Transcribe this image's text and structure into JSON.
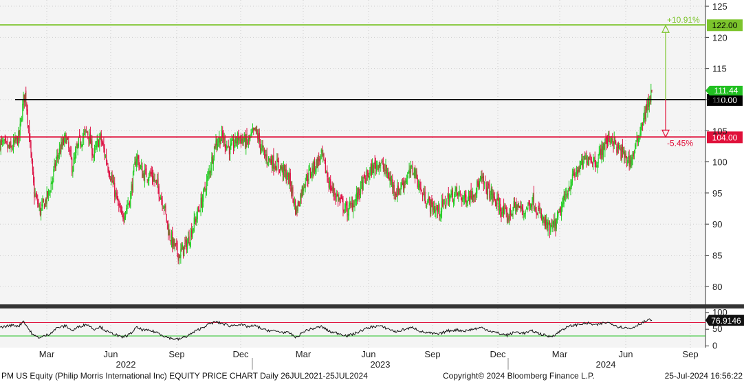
{
  "chart_data": {
    "type": "candlestick",
    "ticker": "PM US Equity",
    "price_axis": {
      "ylim": [
        77,
        126
      ],
      "ticks": [
        "125",
        "120",
        "115",
        "110",
        "105",
        "100",
        "95",
        "90",
        "85",
        "80"
      ]
    },
    "rsi_axis": {
      "ylim": [
        -5,
        112
      ],
      "ticks": [
        "100",
        "50",
        "0"
      ]
    },
    "x_labels": [
      {
        "label": "Mar"
      },
      {
        "label": "Jun"
      },
      {
        "label": "Sep"
      },
      {
        "label": "Dec"
      },
      {
        "label": "Mar"
      },
      {
        "label": "Jun"
      },
      {
        "label": "Sep"
      },
      {
        "label": "Dec"
      },
      {
        "label": "Mar"
      },
      {
        "label": "Jun"
      },
      {
        "label": "Sep"
      }
    ],
    "year_labels": [
      "2022",
      "2023",
      "2024"
    ],
    "horizontal_lines": [
      {
        "value": 122.0,
        "label": "122.00",
        "color": "#7cc42c"
      },
      {
        "value": 110.0,
        "label": "110.00",
        "color": "#000000"
      },
      {
        "value": 104.0,
        "label": "104.00",
        "color": "#e0103a"
      }
    ],
    "last_price": {
      "value": 111.44,
      "label": "111.44",
      "color": "#22c022"
    },
    "annotations": [
      {
        "text": "+10.91%",
        "color": "#7cc42c"
      },
      {
        "text": "-5.45%",
        "color": "#e0103a"
      }
    ],
    "rsi": {
      "last_label": "76.9146",
      "reference_lines": [
        {
          "value": 70,
          "color": "#e0103a"
        },
        {
          "value": 30,
          "color": "#22c022"
        }
      ]
    },
    "price_path": [
      [
        0,
        103
      ],
      [
        5,
        102
      ],
      [
        9,
        104
      ],
      [
        11,
        110
      ],
      [
        12,
        111
      ],
      [
        14,
        103
      ],
      [
        16,
        95
      ],
      [
        19,
        92
      ],
      [
        23,
        95
      ],
      [
        27,
        101
      ],
      [
        31,
        104
      ],
      [
        34,
        99
      ],
      [
        37,
        103
      ],
      [
        41,
        105
      ],
      [
        44,
        101
      ],
      [
        47,
        104
      ],
      [
        51,
        99
      ],
      [
        54,
        95
      ],
      [
        57,
        91
      ],
      [
        61,
        94
      ],
      [
        64,
        101
      ],
      [
        67,
        98
      ],
      [
        71,
        98
      ],
      [
        74,
        96
      ],
      [
        77,
        93
      ],
      [
        79,
        89
      ],
      [
        81,
        87
      ],
      [
        84,
        85
      ],
      [
        88,
        87
      ],
      [
        92,
        91
      ],
      [
        95,
        94
      ],
      [
        98,
        98
      ],
      [
        101,
        103
      ],
      [
        104,
        104
      ],
      [
        108,
        102
      ],
      [
        112,
        104
      ],
      [
        116,
        103
      ],
      [
        120,
        105
      ],
      [
        124,
        101
      ],
      [
        128,
        100
      ],
      [
        132,
        99
      ],
      [
        136,
        97
      ],
      [
        139,
        92
      ],
      [
        143,
        97
      ],
      [
        147,
        99
      ],
      [
        151,
        101
      ],
      [
        155,
        96
      ],
      [
        159,
        94
      ],
      [
        163,
        92
      ],
      [
        167,
        94
      ],
      [
        171,
        97
      ],
      [
        175,
        99
      ],
      [
        178,
        100
      ],
      [
        182,
        98
      ],
      [
        186,
        95
      ],
      [
        190,
        97
      ],
      [
        194,
        99
      ],
      [
        198,
        95
      ],
      [
        202,
        93
      ],
      [
        206,
        92
      ],
      [
        210,
        94
      ],
      [
        214,
        95
      ],
      [
        218,
        94
      ],
      [
        222,
        95
      ],
      [
        226,
        97
      ],
      [
        230,
        95
      ],
      [
        234,
        93
      ],
      [
        238,
        91
      ],
      [
        242,
        93
      ],
      [
        246,
        92
      ],
      [
        250,
        94
      ],
      [
        254,
        91
      ],
      [
        258,
        89
      ],
      [
        261,
        90
      ],
      [
        264,
        93
      ],
      [
        268,
        97
      ],
      [
        272,
        99
      ],
      [
        276,
        101
      ],
      [
        280,
        100
      ],
      [
        284,
        103
      ],
      [
        287,
        104
      ],
      [
        290,
        102
      ],
      [
        293,
        101
      ],
      [
        296,
        100
      ],
      [
        299,
        103
      ],
      [
        301,
        106
      ],
      [
        303,
        108
      ],
      [
        305,
        110
      ],
      [
        306,
        111.44
      ]
    ],
    "rsi_path": [
      [
        0,
        55
      ],
      [
        5,
        62
      ],
      [
        9,
        60
      ],
      [
        11,
        75
      ],
      [
        14,
        45
      ],
      [
        16,
        30
      ],
      [
        19,
        25
      ],
      [
        23,
        35
      ],
      [
        27,
        55
      ],
      [
        31,
        60
      ],
      [
        34,
        45
      ],
      [
        37,
        58
      ],
      [
        41,
        65
      ],
      [
        44,
        50
      ],
      [
        47,
        58
      ],
      [
        51,
        40
      ],
      [
        54,
        35
      ],
      [
        57,
        25
      ],
      [
        61,
        35
      ],
      [
        64,
        55
      ],
      [
        67,
        48
      ],
      [
        71,
        45
      ],
      [
        74,
        40
      ],
      [
        77,
        30
      ],
      [
        79,
        25
      ],
      [
        81,
        22
      ],
      [
        84,
        20
      ],
      [
        88,
        30
      ],
      [
        92,
        45
      ],
      [
        95,
        55
      ],
      [
        98,
        65
      ],
      [
        101,
        72
      ],
      [
        104,
        68
      ],
      [
        108,
        60
      ],
      [
        112,
        65
      ],
      [
        116,
        58
      ],
      [
        120,
        60
      ],
      [
        124,
        48
      ],
      [
        128,
        45
      ],
      [
        132,
        42
      ],
      [
        136,
        38
      ],
      [
        139,
        25
      ],
      [
        143,
        45
      ],
      [
        147,
        52
      ],
      [
        151,
        58
      ],
      [
        155,
        42
      ],
      [
        159,
        38
      ],
      [
        163,
        30
      ],
      [
        167,
        38
      ],
      [
        171,
        50
      ],
      [
        175,
        58
      ],
      [
        178,
        60
      ],
      [
        182,
        52
      ],
      [
        186,
        42
      ],
      [
        190,
        50
      ],
      [
        194,
        55
      ],
      [
        198,
        42
      ],
      [
        202,
        38
      ],
      [
        206,
        35
      ],
      [
        210,
        45
      ],
      [
        214,
        48
      ],
      [
        218,
        45
      ],
      [
        222,
        50
      ],
      [
        226,
        55
      ],
      [
        230,
        45
      ],
      [
        234,
        38
      ],
      [
        238,
        32
      ],
      [
        242,
        42
      ],
      [
        246,
        38
      ],
      [
        250,
        45
      ],
      [
        254,
        35
      ],
      [
        258,
        28
      ],
      [
        261,
        35
      ],
      [
        264,
        50
      ],
      [
        268,
        60
      ],
      [
        272,
        65
      ],
      [
        276,
        68
      ],
      [
        280,
        62
      ],
      [
        284,
        70
      ],
      [
        287,
        68
      ],
      [
        290,
        58
      ],
      [
        293,
        55
      ],
      [
        296,
        52
      ],
      [
        299,
        62
      ],
      [
        301,
        68
      ],
      [
        303,
        74
      ],
      [
        305,
        78
      ],
      [
        306,
        76.9146
      ]
    ]
  },
  "footer": {
    "left": "PM US Equity (Philip Morris International Inc) EQUITY PRICE CHART  Daily 26JUL2021-25JUL2024",
    "center": "Copyright© 2024 Bloomberg Finance L.P.",
    "right": "25-Jul-2024 16:56:22"
  },
  "colors": {
    "up": "#22cc22",
    "down": "#dd1144",
    "background": "#ffffff",
    "grid": "#cccccc"
  }
}
